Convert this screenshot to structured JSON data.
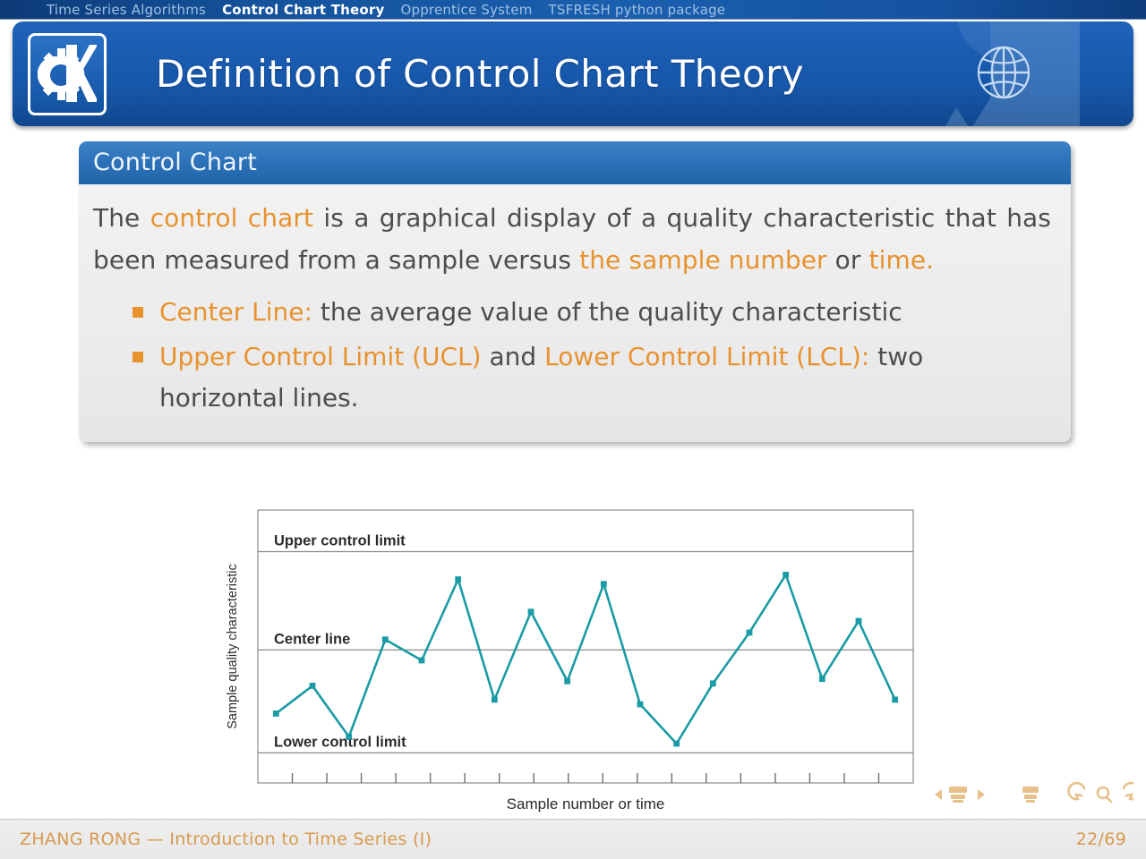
{
  "navbar": {
    "items": [
      {
        "label": "Time Series Algorithms",
        "active": false
      },
      {
        "label": "Control Chart Theory",
        "active": true
      },
      {
        "label": "Opprentice System",
        "active": false
      },
      {
        "label": "TSFRESH python package",
        "active": false
      }
    ]
  },
  "banner": {
    "title": "Definition of Control Chart Theory",
    "logo_icon": "kde-logo-icon",
    "globe_icon": "globe-icon"
  },
  "block": {
    "title": "Control Chart",
    "paragraph": {
      "segments": [
        {
          "text": "The ",
          "highlight": false
        },
        {
          "text": "control chart",
          "highlight": true
        },
        {
          "text": " is a graphical display of a quality characteristic that has been measured from a sample versus ",
          "highlight": false
        },
        {
          "text": "the sample number",
          "highlight": true
        },
        {
          "text": " or ",
          "highlight": false
        },
        {
          "text": "time.",
          "highlight": true
        }
      ],
      "plain": "The control chart is a graphical display of a quality characteristic that has been measured from a sample versus the sample number or time."
    },
    "bullets": [
      {
        "segments": [
          {
            "text": "Center Line:",
            "highlight": true
          },
          {
            "text": " the average value of the quality characteristic",
            "highlight": false
          }
        ]
      },
      {
        "segments": [
          {
            "text": "Upper Control Limit (UCL)",
            "highlight": true
          },
          {
            "text": " and ",
            "highlight": false
          },
          {
            "text": "Lower Control Limit (LCL):",
            "highlight": true
          },
          {
            "text": " two horizontal lines.",
            "highlight": false
          }
        ]
      }
    ]
  },
  "chart_data": {
    "type": "line",
    "title": "",
    "xlabel": "Sample number or time",
    "ylabel": "Sample quality characteristic",
    "grid": false,
    "legend_position": "none",
    "line_color": "#1a9ba5",
    "marker": "square",
    "x": [
      1,
      2,
      3,
      4,
      5,
      6,
      7,
      8,
      9,
      10,
      11,
      12,
      13,
      14,
      15,
      16,
      17,
      18
    ],
    "values": [
      0.3,
      0.42,
      0.2,
      0.62,
      0.53,
      0.88,
      0.36,
      0.74,
      0.44,
      0.86,
      0.34,
      0.17,
      0.43,
      0.65,
      0.9,
      0.45,
      0.7,
      0.36
    ],
    "ylim": [
      0,
      1.18
    ],
    "xlim": [
      0.5,
      18.5
    ],
    "reference_lines": [
      {
        "label": "Upper control limit",
        "value": 1.0
      },
      {
        "label": "Center line",
        "value": 0.575
      },
      {
        "label": "Lower control limit",
        "value": 0.13
      }
    ],
    "tick_count": 18,
    "axis_ticks_labeled": false
  },
  "beamer_nav": {
    "prev_slide_icon": "prev-slide-icon",
    "prev_frame_icon": "prev-frame-icon",
    "next_slide_icon": "next-slide-icon",
    "beamer_icon": "beamer-icon",
    "back_icon": "undo-icon",
    "search_icon": "search-icon",
    "forward_icon": "redo-icon"
  },
  "footer": {
    "author_title": "ZHANG RONG — Introduction to Time Series (I)",
    "page": "22/69"
  }
}
